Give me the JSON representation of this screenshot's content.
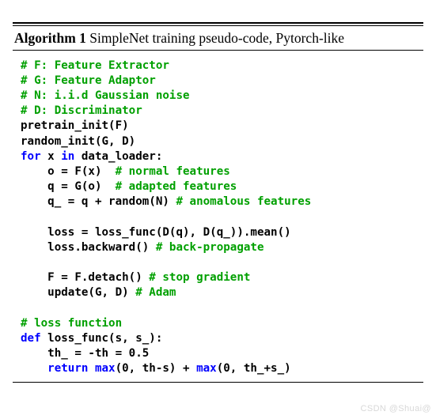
{
  "algorithm": {
    "label": "Algorithm 1",
    "title": "SimpleNet training pseudo-code, Pytorch-like",
    "language": "python",
    "colors": {
      "comment": "#00a000",
      "keyword": "#0000ff",
      "code": "#000000",
      "rule": "#000000",
      "background": "#ffffff",
      "watermark": "#d8d8d8"
    },
    "code_lines": [
      {
        "indent": 0,
        "tokens": [
          {
            "t": "# F: Feature Extractor",
            "k": "com"
          }
        ]
      },
      {
        "indent": 0,
        "tokens": [
          {
            "t": "# G: Feature Adaptor",
            "k": "com"
          }
        ]
      },
      {
        "indent": 0,
        "tokens": [
          {
            "t": "# N: i.i.d Gaussian noise",
            "k": "com"
          }
        ]
      },
      {
        "indent": 0,
        "tokens": [
          {
            "t": "# D: Discriminator",
            "k": "com"
          }
        ]
      },
      {
        "indent": 0,
        "tokens": [
          {
            "t": "pretrain_init(F)",
            "k": "plain"
          }
        ]
      },
      {
        "indent": 0,
        "tokens": [
          {
            "t": "random_init(G, D)",
            "k": "plain"
          }
        ]
      },
      {
        "indent": 0,
        "tokens": [
          {
            "t": "for",
            "k": "kw"
          },
          {
            "t": " x ",
            "k": "plain"
          },
          {
            "t": "in",
            "k": "kw"
          },
          {
            "t": " data_loader:",
            "k": "plain"
          }
        ]
      },
      {
        "indent": 1,
        "tokens": [
          {
            "t": "o = F(x)  ",
            "k": "plain"
          },
          {
            "t": "# normal features",
            "k": "com"
          }
        ]
      },
      {
        "indent": 1,
        "tokens": [
          {
            "t": "q = G(o)  ",
            "k": "plain"
          },
          {
            "t": "# adapted features",
            "k": "com"
          }
        ]
      },
      {
        "indent": 1,
        "tokens": [
          {
            "t": "q_ = q + random(N) ",
            "k": "plain"
          },
          {
            "t": "# anomalous features",
            "k": "com"
          }
        ]
      },
      {
        "indent": 0,
        "blank": true,
        "tokens": []
      },
      {
        "indent": 1,
        "tokens": [
          {
            "t": "loss = loss_func(D(q), D(q_)).mean()",
            "k": "plain"
          }
        ]
      },
      {
        "indent": 1,
        "tokens": [
          {
            "t": "loss.backward() ",
            "k": "plain"
          },
          {
            "t": "# back-propagate",
            "k": "com"
          }
        ]
      },
      {
        "indent": 0,
        "blank": true,
        "tokens": []
      },
      {
        "indent": 1,
        "tokens": [
          {
            "t": "F = F.detach() ",
            "k": "plain"
          },
          {
            "t": "# stop gradient",
            "k": "com"
          }
        ]
      },
      {
        "indent": 1,
        "tokens": [
          {
            "t": "update(G, D) ",
            "k": "plain"
          },
          {
            "t": "# Adam",
            "k": "com"
          }
        ]
      },
      {
        "indent": 0,
        "blank": true,
        "tokens": []
      },
      {
        "indent": 0,
        "tokens": [
          {
            "t": "# loss function",
            "k": "com"
          }
        ]
      },
      {
        "indent": 0,
        "tokens": [
          {
            "t": "def",
            "k": "kw"
          },
          {
            "t": " loss_func(s, s_):",
            "k": "plain"
          }
        ]
      },
      {
        "indent": 1,
        "tokens": [
          {
            "t": "th_ = -th = 0.5",
            "k": "plain"
          }
        ]
      },
      {
        "indent": 1,
        "tokens": [
          {
            "t": "return ",
            "k": "kw"
          },
          {
            "t": "max",
            "k": "kw"
          },
          {
            "t": "(0, th-s) + ",
            "k": "plain"
          },
          {
            "t": "max",
            "k": "kw"
          },
          {
            "t": "(0, th_+s_)",
            "k": "plain"
          }
        ]
      }
    ]
  },
  "watermark": {
    "text": "CSDN @Shuai@"
  }
}
